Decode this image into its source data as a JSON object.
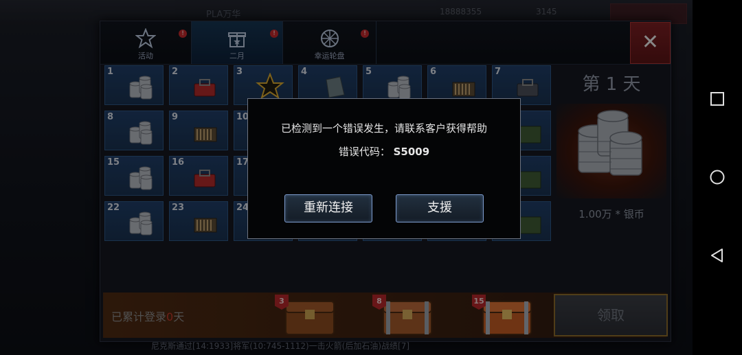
{
  "top_bar": {
    "player_name": "PLA万华",
    "currency_1": "18888355",
    "currency_2": "3145"
  },
  "bottom_ticker": "尼克斯通过[14:1933]将军(10:745-1112)一击火箭(后加石油)战绩[7]",
  "tabs": [
    {
      "label": "活动",
      "badge": "!",
      "icon": "star-badge-icon"
    },
    {
      "label": "二月",
      "badge": "!",
      "icon": "gift-box-icon"
    },
    {
      "label": "幸运轮盘",
      "badge": "!",
      "icon": "wheel-icon"
    }
  ],
  "close_label": "✕",
  "grid_days": [
    {
      "n": "1",
      "item": "silver-coins"
    },
    {
      "n": "2",
      "item": "toolbox"
    },
    {
      "n": "3",
      "item": "gold-star"
    },
    {
      "n": "4",
      "item": "metal-plate"
    },
    {
      "n": "5",
      "item": "silver-coins"
    },
    {
      "n": "6",
      "item": "ammo-crate"
    },
    {
      "n": "7",
      "item": "toolbox-dark"
    },
    {
      "n": "8",
      "item": "silver-coins"
    },
    {
      "n": "9",
      "item": "ammo-crate"
    },
    {
      "n": "10",
      "item": "none"
    },
    {
      "n": "",
      "item": "none"
    },
    {
      "n": "",
      "item": "none"
    },
    {
      "n": "",
      "item": "none"
    },
    {
      "n": "",
      "item": "green-crate"
    },
    {
      "n": "15",
      "item": "silver-coins"
    },
    {
      "n": "16",
      "item": "toolbox"
    },
    {
      "n": "17",
      "item": "none"
    },
    {
      "n": "",
      "item": "none"
    },
    {
      "n": "",
      "item": "none"
    },
    {
      "n": "",
      "item": "none"
    },
    {
      "n": "",
      "item": "green-crate"
    },
    {
      "n": "22",
      "item": "silver-coins"
    },
    {
      "n": "23",
      "item": "ammo-crate"
    },
    {
      "n": "24",
      "item": "none"
    },
    {
      "n": "",
      "item": "none"
    },
    {
      "n": "",
      "item": "none"
    },
    {
      "n": "",
      "item": "none"
    },
    {
      "n": "",
      "item": "green-crate"
    }
  ],
  "reward": {
    "day_label": "第 1 天",
    "item_label": "1.00万 * 银币"
  },
  "login": {
    "label_prefix": "已累计登录",
    "days": "0",
    "label_suffix": "天"
  },
  "chests": [
    {
      "badge": "3"
    },
    {
      "badge": "8"
    },
    {
      "badge": "15"
    }
  ],
  "claim_label": "领取",
  "dialog": {
    "message": "已检测到一个错误发生，请联系客户获得帮助",
    "code_label": "错误代码：",
    "code_value": "S5009",
    "reconnect_label": "重新连接",
    "support_label": "支援"
  },
  "colors": {
    "accent_blue": "#2d5786",
    "alert_red": "#c0292b",
    "dialog_border": "#7e9dcf"
  }
}
